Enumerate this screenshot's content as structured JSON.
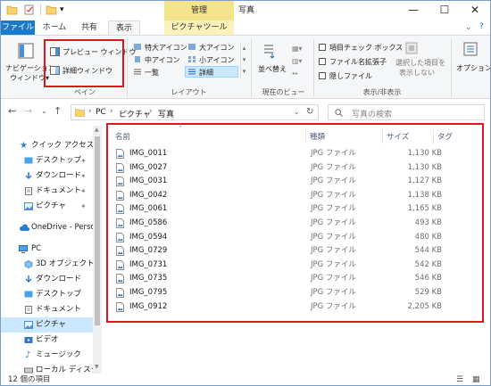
{
  "titlebar": {
    "context_tab": "管理",
    "window_title": "写真",
    "minimize": "—",
    "maximize": "☐",
    "close": "✕"
  },
  "tabs": [
    "ファイル",
    "ホーム",
    "共有",
    "表示",
    "ピクチャツール"
  ],
  "ribbon": {
    "nav_pane_label": "ナビゲーション",
    "nav_pane_label2": "ウィンドウ▾",
    "preview_pane": "プレビュー ウィンドウ",
    "details_pane": "詳細ウィンドウ",
    "group_pane": "ペイン",
    "layout_items": [
      "特大アイコン",
      "大アイコン",
      "中アイコン",
      "小アイコン",
      "一覧",
      "詳細"
    ],
    "group_layout": "レイアウト",
    "sort_label": "並べ替え",
    "sort_label2": "え▾",
    "group_current_view": "現在のビュー",
    "checkboxes": [
      "項目チェック ボックス",
      "ファイル名拡張子",
      "隠しファイル"
    ],
    "hide_selected": "選択した項目を",
    "hide_selected2": "表示しない",
    "group_show_hide": "表示/非表示",
    "options": "オプション"
  },
  "address": {
    "segments": [
      "PC",
      "ピクチャ",
      "写真"
    ],
    "search_placeholder": "写真の検索"
  },
  "navpane": {
    "items": [
      {
        "label": "クイック アクセス",
        "icon": "star-icon",
        "pinned": false
      },
      {
        "label": "デスクトップ",
        "icon": "desktop-folder-icon",
        "pinned": true
      },
      {
        "label": "ダウンロード",
        "icon": "download-folder-icon",
        "pinned": true
      },
      {
        "label": "ドキュメント",
        "icon": "documents-folder-icon",
        "pinned": true
      },
      {
        "label": "ピクチャ",
        "icon": "pictures-folder-icon",
        "pinned": true
      },
      {
        "label": "OneDrive - Person",
        "icon": "cloud-icon",
        "pinned": false
      },
      {
        "label": "PC",
        "icon": "pc-icon",
        "pinned": false
      },
      {
        "label": "3D オブジェクト",
        "icon": "3d-objects-icon",
        "pinned": false
      },
      {
        "label": "ダウンロード",
        "icon": "download-folder-icon",
        "pinned": false
      },
      {
        "label": "デスクトップ",
        "icon": "desktop-folder-icon",
        "pinned": false
      },
      {
        "label": "ドキュメント",
        "icon": "documents-folder-icon",
        "pinned": false
      },
      {
        "label": "ピクチャ",
        "icon": "pictures-folder-icon",
        "pinned": false
      },
      {
        "label": "ビデオ",
        "icon": "video-folder-icon",
        "pinned": false
      },
      {
        "label": "ミュージック",
        "icon": "music-folder-icon",
        "pinned": false
      },
      {
        "label": "ローカル ディスク",
        "icon": "disk-icon",
        "pinned": false
      }
    ]
  },
  "columns": [
    "名前",
    "種類",
    "サイズ",
    "タグ"
  ],
  "files": [
    {
      "name": "IMG_0011",
      "type": "JPG ファイル",
      "size": "1,130 KB"
    },
    {
      "name": "IMG_0027",
      "type": "JPG ファイル",
      "size": "1,130 KB"
    },
    {
      "name": "IMG_0031",
      "type": "JPG ファイル",
      "size": "1,127 KB"
    },
    {
      "name": "IMG_0042",
      "type": "JPG ファイル",
      "size": "1,138 KB"
    },
    {
      "name": "IMG_0061",
      "type": "JPG ファイル",
      "size": "1,165 KB"
    },
    {
      "name": "IMG_0586",
      "type": "JPG ファイル",
      "size": "493 KB"
    },
    {
      "name": "IMG_0594",
      "type": "JPG ファイル",
      "size": "480 KB"
    },
    {
      "name": "IMG_0729",
      "type": "JPG ファイル",
      "size": "544 KB"
    },
    {
      "name": "IMG_0731",
      "type": "JPG ファイル",
      "size": "542 KB"
    },
    {
      "name": "IMG_0735",
      "type": "JPG ファイル",
      "size": "546 KB"
    },
    {
      "name": "IMG_0795",
      "type": "JPG ファイル",
      "size": "529 KB"
    },
    {
      "name": "IMG_0912",
      "type": "JPG ファイル",
      "size": "2,205 KB"
    }
  ],
  "status": {
    "count": "12 個の項目"
  },
  "colors": {
    "accent": "#1979ca",
    "highlight": "#e0161e",
    "picture_tools": "#f3e38a",
    "selected": "#cce8ff"
  }
}
